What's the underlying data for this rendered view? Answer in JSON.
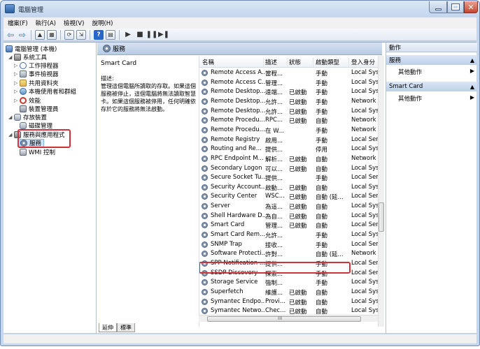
{
  "window": {
    "title": "電腦管理"
  },
  "menu": [
    "檔案(F)",
    "執行(A)",
    "檢視(V)",
    "說明(H)"
  ],
  "tree": {
    "root": "電腦管理 (本機)",
    "system_tools": "系統工具",
    "task_scheduler": "工作排程器",
    "event_viewer": "事件檢視器",
    "shared_folders": "共用資料夾",
    "local_users": "本機使用者和群組",
    "performance": "效能",
    "device_manager": "裝置管理員",
    "storage": "存放裝置",
    "disk_mgmt": "磁碟管理",
    "services_apps": "服務與應用程式",
    "services": "服務",
    "wmi": "WMI 控制"
  },
  "center": {
    "header": "服務",
    "selected_service": "Smart Card",
    "desc_label": "描述:",
    "desc_text": "管理這個電腦所讀取的存取。如果這個服務被停止，這個電腦將無法讀取智慧卡。如果這個服務被停用，任何明確依存於它的服務將無法啟動。",
    "tabs": [
      "延伸",
      "標準"
    ],
    "columns": [
      "名稱",
      "描述",
      "狀態",
      "啟動類型",
      "登入身分"
    ]
  },
  "services": [
    {
      "name": "Remote Access A...",
      "desc": "當程...",
      "status": "",
      "startup": "手動",
      "logon": "Local Sys"
    },
    {
      "name": "Remote Access C...",
      "desc": "管理...",
      "status": "",
      "startup": "手動",
      "logon": "Local Sys"
    },
    {
      "name": "Remote Desktop...",
      "desc": "遠端...",
      "status": "已啟動",
      "startup": "手動",
      "logon": "Local Sys"
    },
    {
      "name": "Remote Desktop...",
      "desc": "允許...",
      "status": "已啟動",
      "startup": "手動",
      "logon": "Network"
    },
    {
      "name": "Remote Desktop...",
      "desc": "允許...",
      "status": "已啟動",
      "startup": "手動",
      "logon": "Local Sys"
    },
    {
      "name": "Remote Procedu...",
      "desc": "RPC...",
      "status": "已啟動",
      "startup": "自動",
      "logon": "Network"
    },
    {
      "name": "Remote Procedu...",
      "desc": "在 W...",
      "status": "",
      "startup": "手動",
      "logon": "Network"
    },
    {
      "name": "Remote Registry",
      "desc": "啟用...",
      "status": "",
      "startup": "手動",
      "logon": "Local Ser"
    },
    {
      "name": "Routing and Re...",
      "desc": "提供...",
      "status": "",
      "startup": "停用",
      "logon": "Local Sys"
    },
    {
      "name": "RPC Endpoint M...",
      "desc": "解析...",
      "status": "已啟動",
      "startup": "自動",
      "logon": "Network"
    },
    {
      "name": "Secondary Logon",
      "desc": "可以...",
      "status": "已啟動",
      "startup": "自動",
      "logon": "Local Sys"
    },
    {
      "name": "Secure Socket Tu...",
      "desc": "提供...",
      "status": "",
      "startup": "手動",
      "logon": "Local Ser"
    },
    {
      "name": "Security Account...",
      "desc": "啟動...",
      "status": "已啟動",
      "startup": "自動",
      "logon": "Local Sys"
    },
    {
      "name": "Security Center",
      "desc": "WSC...",
      "status": "已啟動",
      "startup": "自動 (延...",
      "logon": "Local Ser"
    },
    {
      "name": "Server",
      "desc": "為這...",
      "status": "已啟動",
      "startup": "自動",
      "logon": "Local Sys"
    },
    {
      "name": "Shell Hardware D...",
      "desc": "為自...",
      "status": "已啟動",
      "startup": "自動",
      "logon": "Local Sys"
    },
    {
      "name": "Smart Card",
      "desc": "管理...",
      "status": "已啟動",
      "startup": "自動",
      "logon": "Local Ser"
    },
    {
      "name": "Smart Card Rem...",
      "desc": "允許...",
      "status": "",
      "startup": "手動",
      "logon": "Local Sys"
    },
    {
      "name": "SNMP Trap",
      "desc": "接收...",
      "status": "",
      "startup": "手動",
      "logon": "Local Ser"
    },
    {
      "name": "Software Protecti...",
      "desc": "許對...",
      "status": "",
      "startup": "自動 (延...",
      "logon": "Network"
    },
    {
      "name": "SPP Notification ...",
      "desc": "提供...",
      "status": "",
      "startup": "手動",
      "logon": "Local Ser"
    },
    {
      "name": "SSDP Discovery",
      "desc": "探索...",
      "status": "",
      "startup": "手動",
      "logon": "Local Ser"
    },
    {
      "name": "Storage Service",
      "desc": "強制...",
      "status": "",
      "startup": "手動",
      "logon": "Local Sys"
    },
    {
      "name": "Superfetch",
      "desc": "維護...",
      "status": "已啟動",
      "startup": "自動",
      "logon": "Local Sys"
    },
    {
      "name": "Symantec Endpo...",
      "desc": "Provi...",
      "status": "已啟動",
      "startup": "自動",
      "logon": "Local Sys"
    },
    {
      "name": "Symantec Netwo...",
      "desc": "Chec...",
      "status": "已啟動",
      "startup": "自動",
      "logon": "Local Sys"
    }
  ],
  "actions": {
    "header": "動作",
    "section1": "服務",
    "more1": "其他動作",
    "section2": "Smart Card",
    "more2": "其他動作"
  },
  "scroll_label": "III",
  "colors": {
    "highlight_box": "#d0323a",
    "header_bg": "#c4d7ee"
  }
}
